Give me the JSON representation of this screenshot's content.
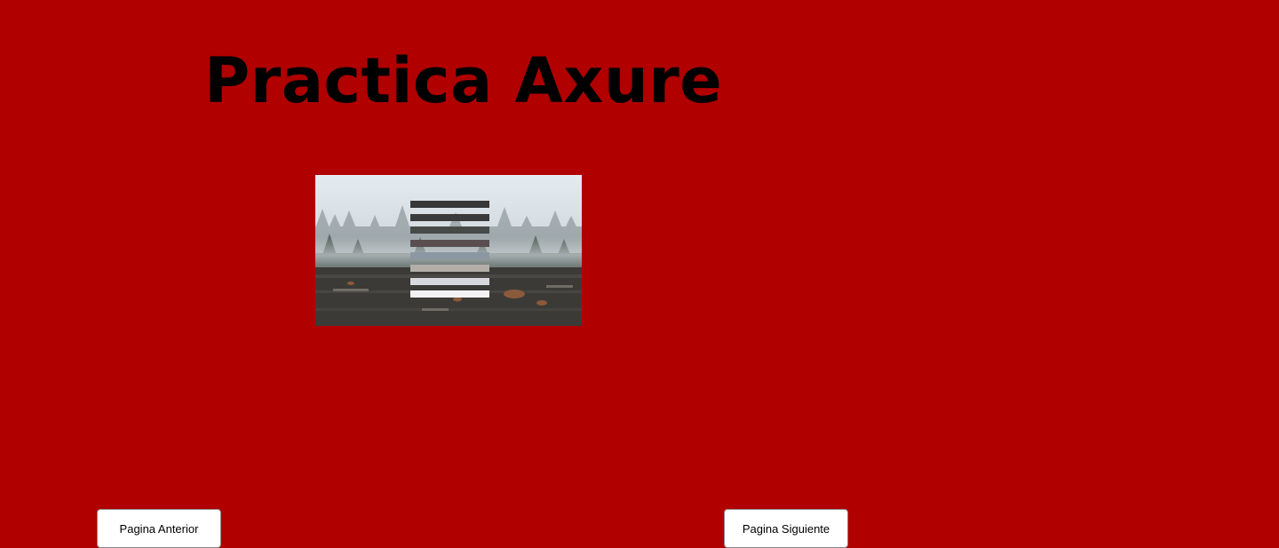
{
  "page": {
    "title": "Practica Axure",
    "background_color": "#b00000"
  },
  "image": {
    "subject": "foggy forest clearing with striped overlay",
    "overlay_icon": "hamburger-menu-icon"
  },
  "navigation": {
    "prev_label": "Pagina Anterior",
    "next_label": "Pagina Siguiente"
  }
}
